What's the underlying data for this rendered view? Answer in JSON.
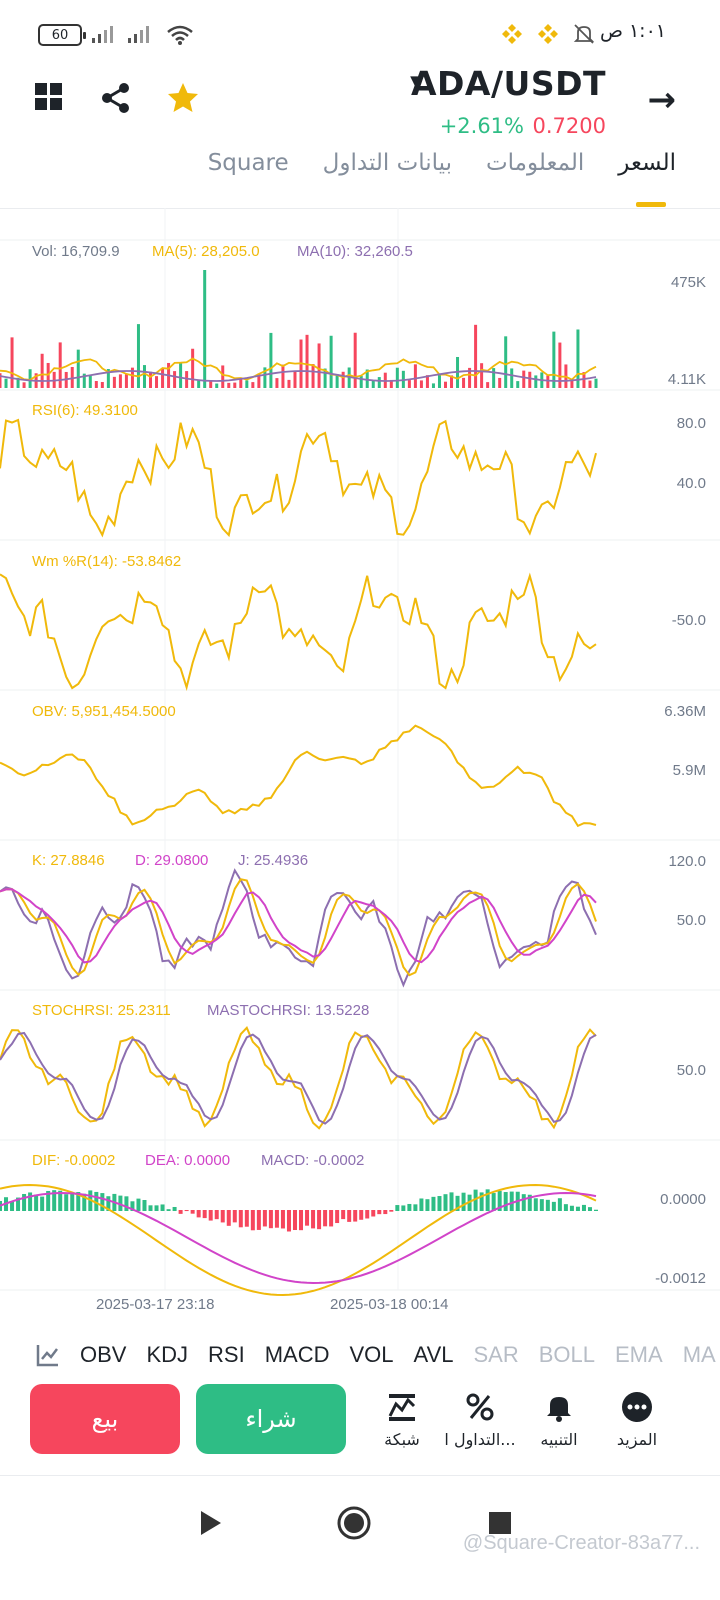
{
  "status_bar": {
    "battery": "60",
    "time": "١:٠١ ص",
    "icons": [
      "signal-icon",
      "wifi-icon",
      "binance-icon",
      "mute-icon"
    ]
  },
  "header": {
    "pair": "ADA/USDT",
    "change": "+2.61%",
    "price": "0.7200",
    "icons": [
      "grid-icon",
      "share-icon",
      "star-icon",
      "back-arrow-icon",
      "caret-down-icon"
    ]
  },
  "tabs": [
    {
      "label": "السعر",
      "active": true
    },
    {
      "label": "المعلومات",
      "active": false
    },
    {
      "label": "بيانات التداول",
      "active": false
    },
    {
      "label": "Square",
      "active": false
    }
  ],
  "panels": {
    "vol": {
      "vol_label": "Vol: 16,709.9",
      "ma5_label": "MA(5): 28,205.0",
      "ma10_label": "MA(10): 32,260.5",
      "axis_top": "475K",
      "axis_bottom": "4.11K"
    },
    "rsi": {
      "label": "RSI(6): 49.3100",
      "axis_top": "80.0",
      "axis_mid": "40.0"
    },
    "wr": {
      "label": "Wm %R(14): -53.8462",
      "axis_mid": "-50.0"
    },
    "obv": {
      "label": "OBV: 5,951,454.5000",
      "axis_top": "6.36M",
      "axis_mid": "5.9M"
    },
    "kdj": {
      "k_label": "K: 27.8846",
      "d_label": "D: 29.0800",
      "j_label": "J: 25.4936",
      "axis_top": "120.0",
      "axis_mid": "50.0"
    },
    "stochrsi": {
      "stoch_label": "STOCHRSI: 25.2311",
      "ma_label": "MASTOCHRSI: 13.5228",
      "axis_mid": "50.0"
    },
    "macd": {
      "dif_label": "DIF: -0.0002",
      "dea_label": "DEA: 0.0000",
      "macd_label": "MACD: -0.0002",
      "axis_top": "0.0000",
      "axis_bottom": "-0.0012"
    }
  },
  "dates": [
    "2025-03-17 23:18",
    "2025-03-18 00:14"
  ],
  "indicators": [
    {
      "label": "OBV",
      "active": true
    },
    {
      "label": "KDJ",
      "active": true
    },
    {
      "label": "RSI",
      "active": true
    },
    {
      "label": "MACD",
      "active": true
    },
    {
      "label": "VOL",
      "active": true
    },
    {
      "label": "AVL",
      "active": true
    },
    {
      "label": "SAR",
      "active": false
    },
    {
      "label": "BOLL",
      "active": false
    },
    {
      "label": "EMA",
      "active": false
    },
    {
      "label": "MA",
      "active": false
    }
  ],
  "actions": {
    "sell": "بيع",
    "buy": "شراء",
    "grid": "شبكة",
    "trade": "التداول ا...",
    "alert": "التنبيه",
    "more": "المزيد"
  },
  "watermark": "@Square-Creator-83a77...",
  "colors": {
    "yellow": "#f0b90b",
    "purple": "#8d6fb0",
    "magenta": "#d144c9",
    "green": "#2ebd85",
    "red": "#f6465d"
  }
}
